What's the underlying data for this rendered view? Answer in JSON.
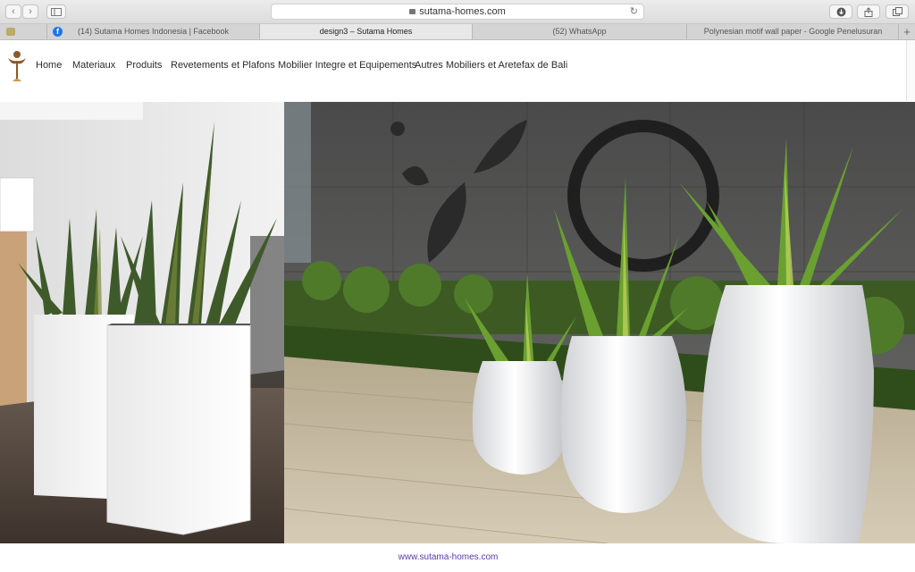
{
  "browser": {
    "url": "sutama-homes.com",
    "tabs": [
      {
        "label": "(14) Sutama Homes Indonesia | Facebook",
        "active": false
      },
      {
        "label": "design3 – Sutama Homes",
        "active": true
      },
      {
        "label": "(52) WhatsApp",
        "active": false
      },
      {
        "label": "Polynesian motif wall paper - Google Penelusuran",
        "active": false
      }
    ]
  },
  "site": {
    "nav": [
      "Home",
      "Materiaux",
      "Produits",
      "Revetements et Plafons",
      "Mobilier Integre et Equipements",
      "Autres Mobiliers et Aretefax de Bali"
    ],
    "footer_link": "www.sutama-homes.com"
  },
  "colors": {
    "accent_link": "#5a3aa8",
    "logo_brown": "#8b5a2b",
    "facebook_blue": "#1877f2"
  }
}
